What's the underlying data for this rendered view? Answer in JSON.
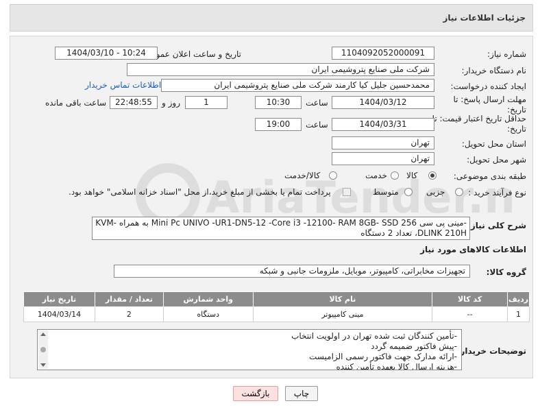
{
  "header": {
    "title": "جزئیات اطلاعات نیاز"
  },
  "fields": {
    "need_number": {
      "label": "شماره نیاز:",
      "value": "1104092052000091"
    },
    "announce_datetime": {
      "label": "تاریخ و ساعت اعلان عمومی:",
      "value": "1404/03/10 - 10:24"
    },
    "buyer_org": {
      "label": "نام دستگاه خریدار:",
      "value": "شرکت ملی صنایع پتروشیمی ایران"
    },
    "requester": {
      "label": "ایجاد کننده درخواست:",
      "value": "محمدحسین جلیل کیا کارمند شرکت ملی صنایع پتروشیمی ایران",
      "link": "اطلاعات تماس خریدار"
    },
    "reply_deadline": {
      "label": "مهلت ارسال پاسخ: تا تاریخ:",
      "date": "1404/03/12",
      "time_label": "ساعت",
      "time": "10:30",
      "days": "1",
      "days_label": "روز و",
      "remaining": "22:48:55",
      "remaining_label": "ساعت باقی مانده"
    },
    "price_validity": {
      "label": "حداقل تاریخ اعتبار قیمت: تا تاریخ:",
      "date": "1404/03/31",
      "time_label": "ساعت",
      "time": "19:00"
    },
    "delivery_province": {
      "label": "استان محل تحویل:",
      "value": "تهران"
    },
    "delivery_city": {
      "label": "شهر محل تحویل:",
      "value": "تهران"
    },
    "category": {
      "label": "طبقه بندی موضوعی:",
      "options": [
        "کالا",
        "خدمت",
        "کالا/خدمت"
      ],
      "selected": "کالا"
    },
    "process_type": {
      "label": "نوع فرآیند خرید :",
      "options": [
        "جزیی",
        "متوسط"
      ],
      "selected": "",
      "payment_note": "پرداخت تمام یا بخشی از مبلغ خرید،از محل \"اسناد خزانه اسلامی\" خواهد بود."
    }
  },
  "description": {
    "label": "شرح کلی نیاز:",
    "value": "-مینی پی سی Mini Pc UNIVO -UR1-DN5-12 -Core i3 -12100- RAM 8GB- SSD 256 به همراه KVM-DLINK 210H، تعداد 2 دستگاه"
  },
  "goods_info": {
    "title": "اطلاعات کالاهای مورد نیاز"
  },
  "goods_group": {
    "label": "گروه کالا:",
    "value": "تجهیزات مخابراتی، کامپیوتر، موبایل، ملزومات جانبی و شبکه"
  },
  "table": {
    "headers": [
      "ردیف",
      "کد کالا",
      "نام کالا",
      "واحد شمارش",
      "تعداد / مقدار",
      "تاریخ نیاز"
    ],
    "rows": [
      [
        "1",
        "--",
        "مینی کامپیوتر",
        "دستگاه",
        "2",
        "1404/03/14"
      ]
    ]
  },
  "buyer_notes": {
    "label": "توضیحات خریدار:",
    "lines": [
      "-تأمین کنندگان ثبت شده تهران در اولویت انتخاب",
      "-پیش فاکتور ضمیمه گردد",
      "-ارائه مدارک جهت فاکتور رسمی الزامیست",
      "-هزینه ارسال کالا بعهده تأمین کننده"
    ]
  },
  "buttons": {
    "print": "چاپ",
    "back": "بازگشت"
  },
  "watermark": {
    "text": "AriaTender.neT"
  }
}
